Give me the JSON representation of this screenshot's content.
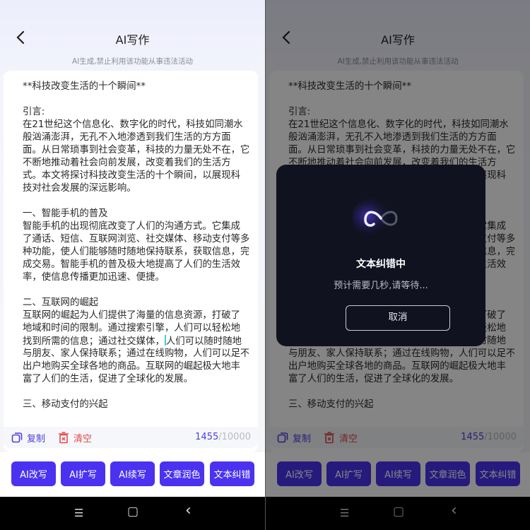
{
  "header": {
    "title": "AI写作",
    "subtitle": "AI生成,禁止利用该功能从事违法活动",
    "back_icon": "chevron-left-icon"
  },
  "editor": {
    "lines": [
      "**科技改变生活的十个瞬间**",
      "",
      "引言:",
      "在21世纪这个信息化、数字化的时代，科技如同潮水",
      "般汹涌澎湃，无孔不入地渗透到我们生活的方方面",
      "面。从日常琐事到社会变革，科技的力量无处不在，它",
      "不断地推动着社会向前发展，改变着我们的生活方",
      "式。本文将探讨科技改变生活的十个瞬间，以展现科",
      "技对社会发展的深远影响。",
      "",
      "一、智能手机的普及",
      "智能手机的出现彻底改变了人们的沟通方式。它集成",
      "了通话、短信、互联网浏览、社交媒体、移动支付等多",
      "种功能，使人们能够随时随地保持联系，获取信息，完",
      "成交易。智能手机的普及极大地提高了人们的生活效",
      "率，使信息传播更加迅速、便捷。",
      "",
      "二、互联网的崛起",
      "互联网的崛起为人们提供了海量的信息资源，打破了",
      "地域和时间的限制。通过搜索引擎，人们可以轻松地",
      "找到所需的信息；通过社交媒体，人们可以随时随地",
      "与朋友、家人保持联系；通过在线购物，人们可以足不",
      "出户地购买全球各地的商品。互联网的崛起极大地丰",
      "富了人们的生活，促进了全球化的发展。",
      "",
      "三、移动支付的兴起"
    ]
  },
  "toolbar": {
    "copy_label": "复制",
    "clear_label": "清空",
    "count_current": "1455",
    "count_max": "/10000"
  },
  "actions": [
    "AI改写",
    "AI扩写",
    "AI续写",
    "文章润色",
    "文本纠错"
  ],
  "navbar": {
    "menu": "☰",
    "home": "▢",
    "back": "‹"
  },
  "modal": {
    "title": "文本纠错中",
    "description": "预计需要几秒,请等待...",
    "cancel_label": "取消",
    "icon": "infinity-loading-icon"
  },
  "colors": {
    "accent": "#4b32f0",
    "danger": "#e24a4a",
    "modal_bg": "#10121f"
  }
}
